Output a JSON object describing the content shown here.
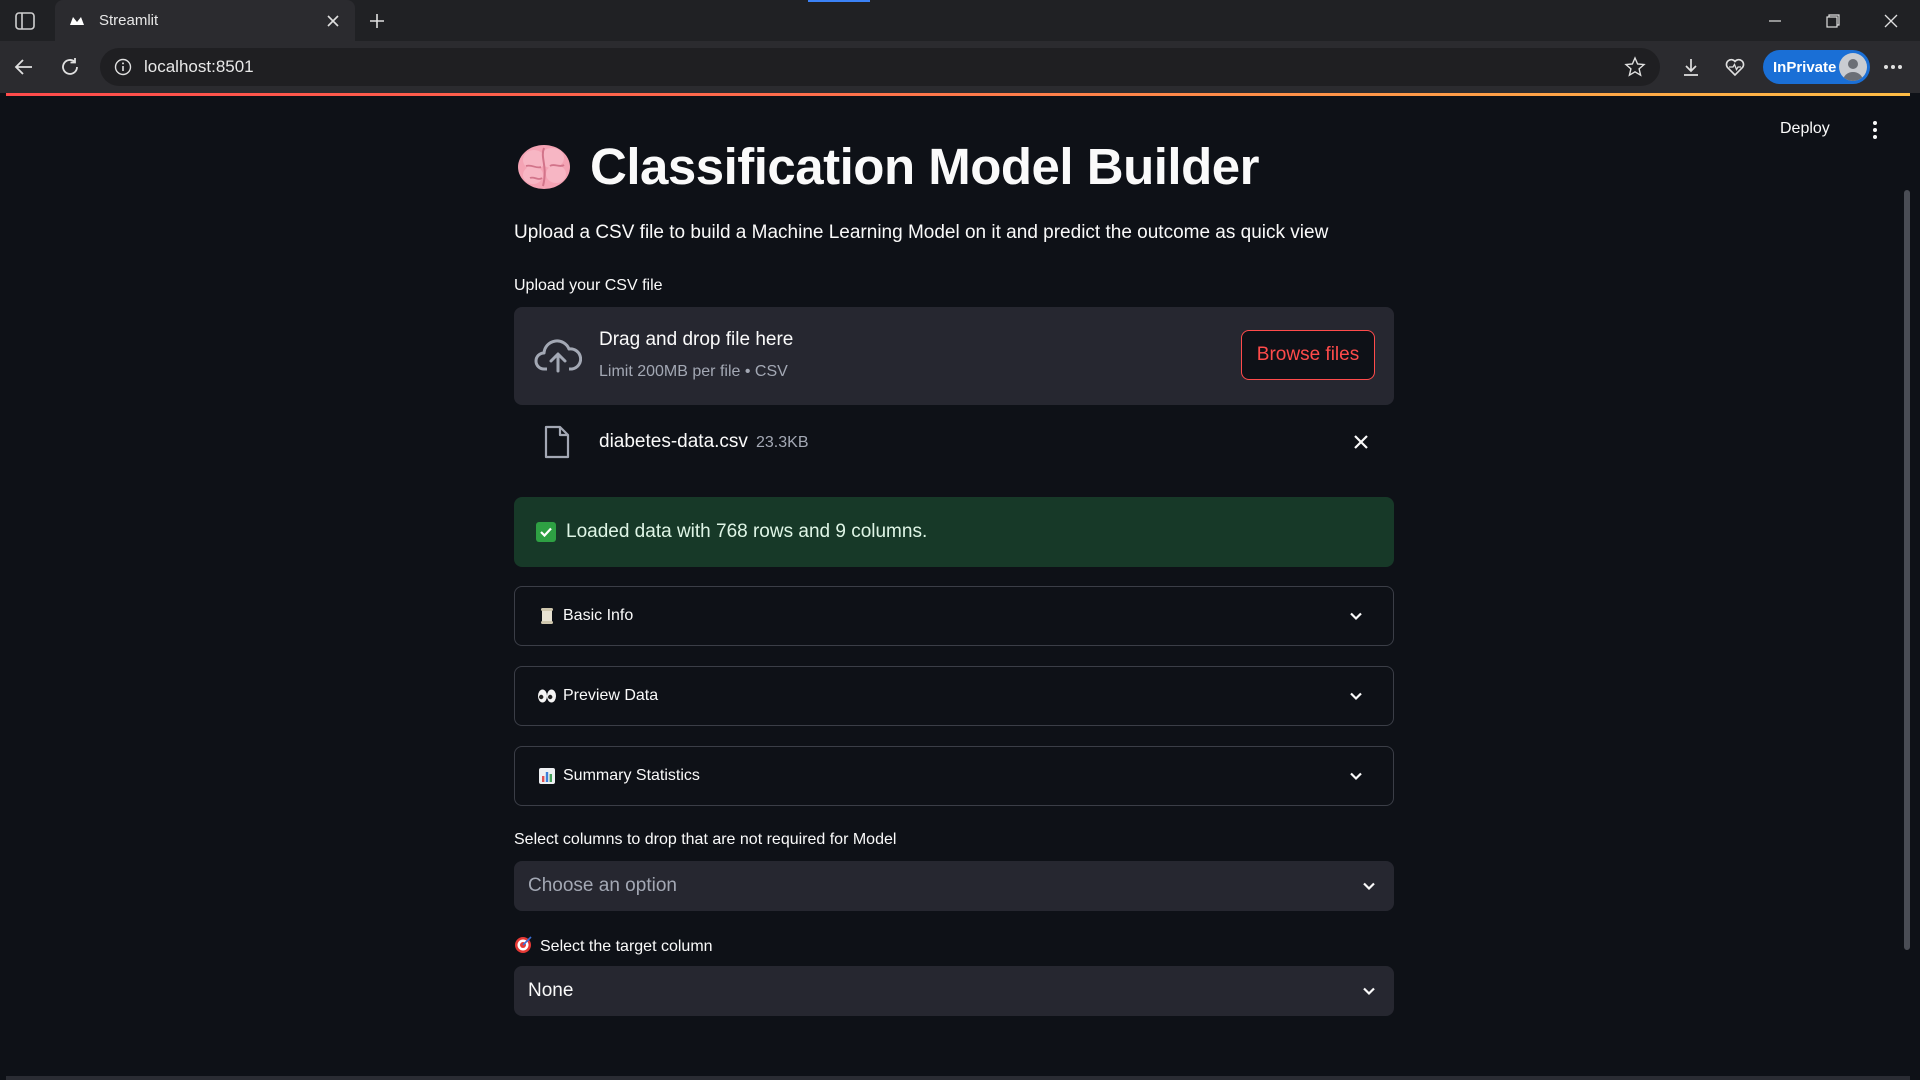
{
  "browser": {
    "tab_title": "Streamlit",
    "url": "localhost:8501",
    "inprivate_label": "InPrivate"
  },
  "app": {
    "deploy_label": "Deploy",
    "title": "Classification Model Builder",
    "subtitle": "Upload a CSV file to build a Machine Learning Model on it and predict the outcome as quick view",
    "uploader": {
      "label": "Upload your CSV file",
      "drop_text": "Drag and drop file here",
      "limit_text": "Limit 200MB per file • CSV",
      "browse_label": "Browse files"
    },
    "uploaded_file": {
      "name": "diabetes-data.csv",
      "size": "23.3KB"
    },
    "success_message": "Loaded data with 768 rows and 9 columns.",
    "expanders": [
      {
        "label": "Basic Info",
        "icon": "scroll-icon"
      },
      {
        "label": "Preview Data",
        "icon": "eyes-icon"
      },
      {
        "label": "Summary Statistics",
        "icon": "bar-chart-icon"
      }
    ],
    "drop_columns": {
      "label": "Select columns to drop that are not required for Model",
      "placeholder": "Choose an option"
    },
    "target_column": {
      "label": "Select the target column",
      "value": "None"
    }
  },
  "colors": {
    "background": "#0e1117",
    "accent": "#ff4b4b",
    "success_bg": "#173928",
    "widget_bg": "#262730"
  }
}
